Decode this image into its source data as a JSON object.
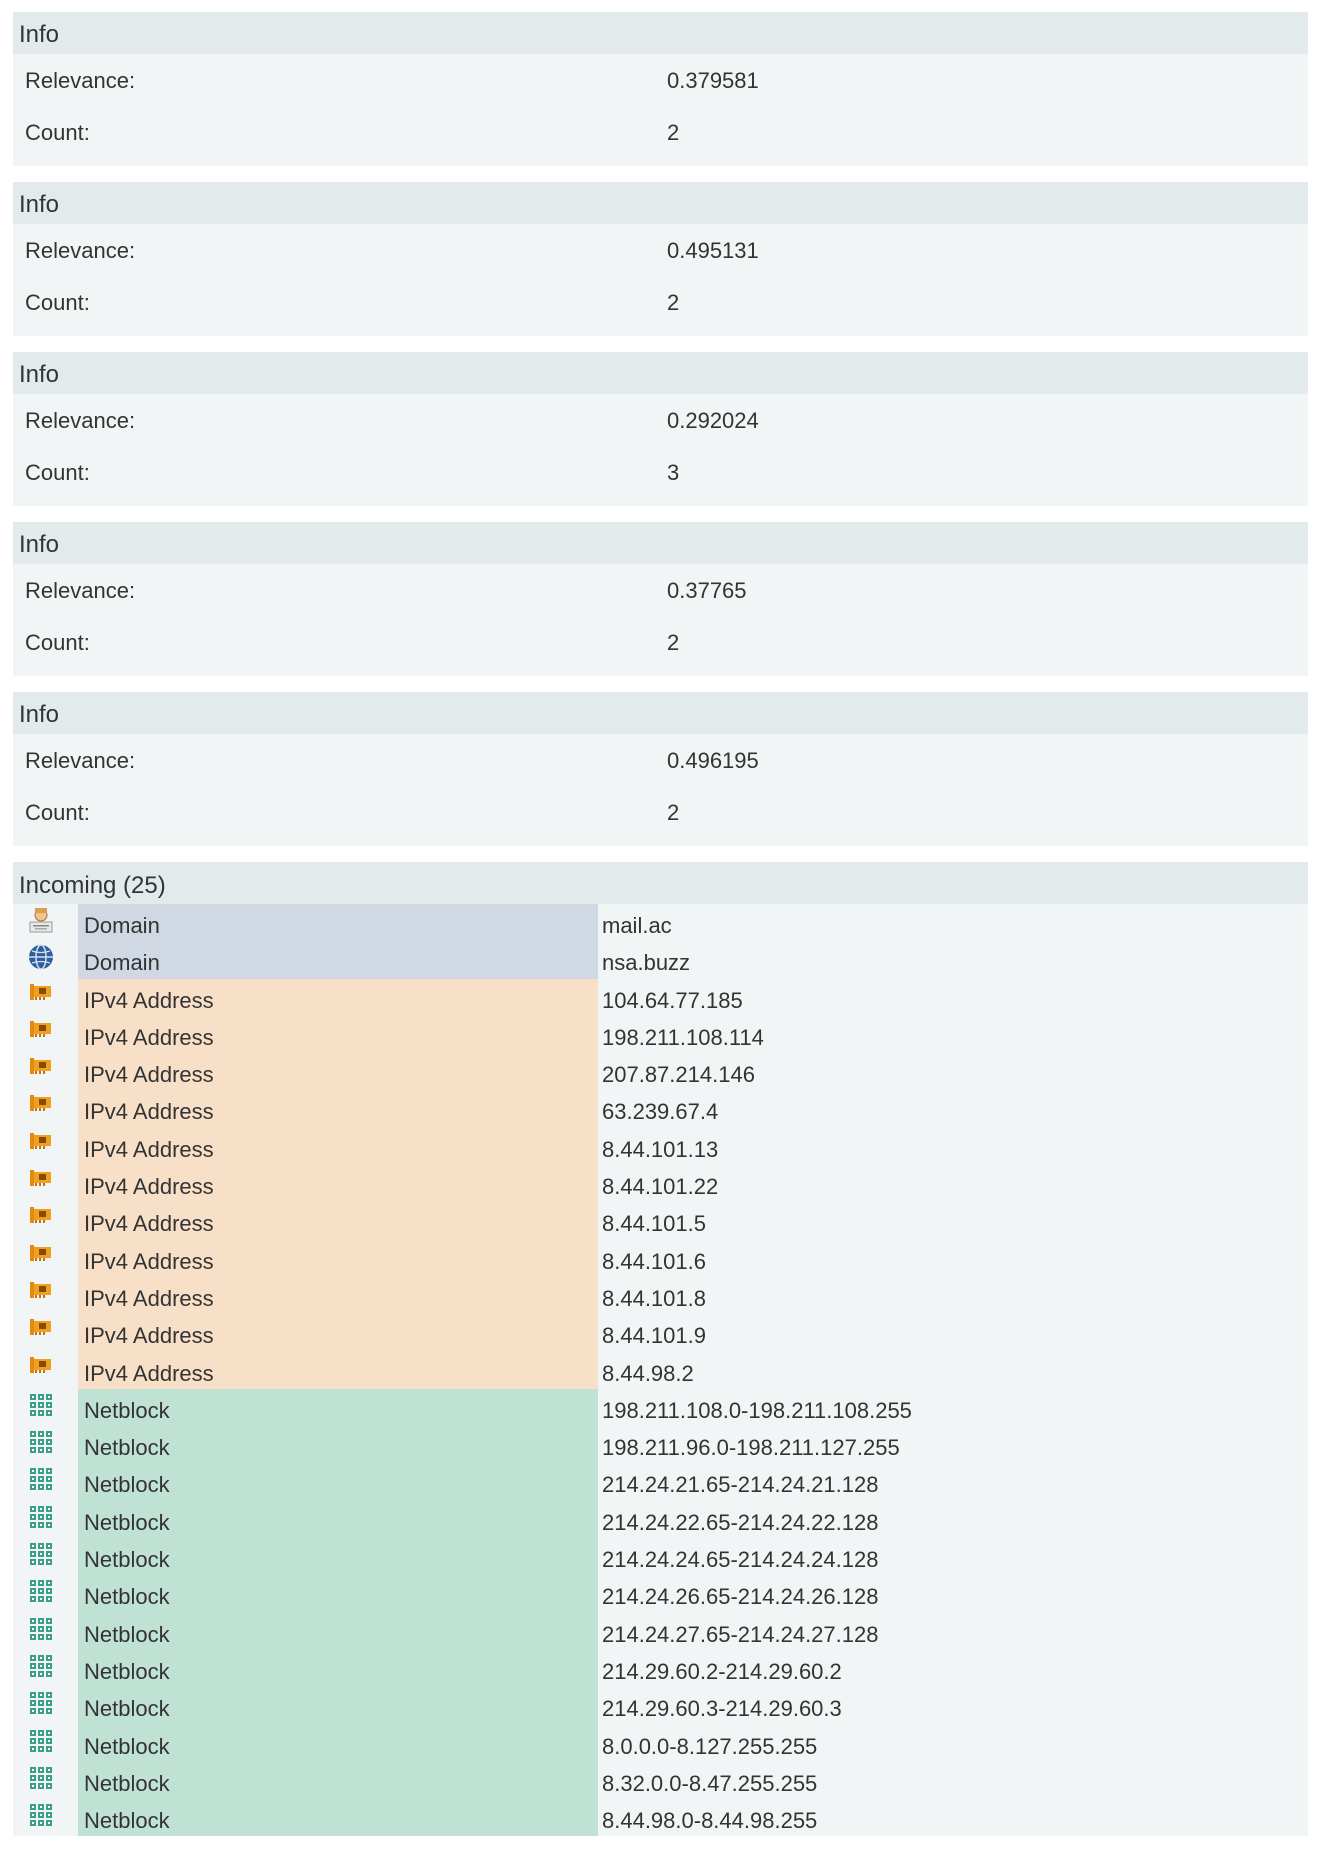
{
  "info_panels": [
    {
      "title": "Info",
      "relevance_label": "Relevance:",
      "relevance": "0.379581",
      "count_label": "Count:",
      "count": "2"
    },
    {
      "title": "Info",
      "relevance_label": "Relevance:",
      "relevance": "0.495131",
      "count_label": "Count:",
      "count": "2"
    },
    {
      "title": "Info",
      "relevance_label": "Relevance:",
      "relevance": "0.292024",
      "count_label": "Count:",
      "count": "3"
    },
    {
      "title": "Info",
      "relevance_label": "Relevance:",
      "relevance": "0.37765",
      "count_label": "Count:",
      "count": "2"
    },
    {
      "title": "Info",
      "relevance_label": "Relevance:",
      "relevance": "0.496195",
      "count_label": "Count:",
      "count": "2"
    }
  ],
  "incoming": {
    "title": "Incoming (25)",
    "rows": [
      {
        "icon": "person-icon",
        "type": "Domain",
        "kind": "domain",
        "value": "mail.ac"
      },
      {
        "icon": "globe-icon",
        "type": "Domain",
        "kind": "domain",
        "value": "nsa.buzz"
      },
      {
        "icon": "network-card-icon",
        "type": "IPv4 Address",
        "kind": "ipv4",
        "value": "104.64.77.185"
      },
      {
        "icon": "network-card-icon",
        "type": "IPv4 Address",
        "kind": "ipv4",
        "value": "198.211.108.114"
      },
      {
        "icon": "network-card-icon",
        "type": "IPv4 Address",
        "kind": "ipv4",
        "value": "207.87.214.146"
      },
      {
        "icon": "network-card-icon",
        "type": "IPv4 Address",
        "kind": "ipv4",
        "value": "63.239.67.4"
      },
      {
        "icon": "network-card-icon",
        "type": "IPv4 Address",
        "kind": "ipv4",
        "value": "8.44.101.13"
      },
      {
        "icon": "network-card-icon",
        "type": "IPv4 Address",
        "kind": "ipv4",
        "value": "8.44.101.22"
      },
      {
        "icon": "network-card-icon",
        "type": "IPv4 Address",
        "kind": "ipv4",
        "value": "8.44.101.5"
      },
      {
        "icon": "network-card-icon",
        "type": "IPv4 Address",
        "kind": "ipv4",
        "value": "8.44.101.6"
      },
      {
        "icon": "network-card-icon",
        "type": "IPv4 Address",
        "kind": "ipv4",
        "value": "8.44.101.8"
      },
      {
        "icon": "network-card-icon",
        "type": "IPv4 Address",
        "kind": "ipv4",
        "value": "8.44.101.9"
      },
      {
        "icon": "network-card-icon",
        "type": "IPv4 Address",
        "kind": "ipv4",
        "value": "8.44.98.2"
      },
      {
        "icon": "netblock-icon",
        "type": "Netblock",
        "kind": "netblock",
        "value": "198.211.108.0-198.211.108.255"
      },
      {
        "icon": "netblock-icon",
        "type": "Netblock",
        "kind": "netblock",
        "value": "198.211.96.0-198.211.127.255"
      },
      {
        "icon": "netblock-icon",
        "type": "Netblock",
        "kind": "netblock",
        "value": "214.24.21.65-214.24.21.128"
      },
      {
        "icon": "netblock-icon",
        "type": "Netblock",
        "kind": "netblock",
        "value": "214.24.22.65-214.24.22.128"
      },
      {
        "icon": "netblock-icon",
        "type": "Netblock",
        "kind": "netblock",
        "value": "214.24.24.65-214.24.24.128"
      },
      {
        "icon": "netblock-icon",
        "type": "Netblock",
        "kind": "netblock",
        "value": "214.24.26.65-214.24.26.128"
      },
      {
        "icon": "netblock-icon",
        "type": "Netblock",
        "kind": "netblock",
        "value": "214.24.27.65-214.24.27.128"
      },
      {
        "icon": "netblock-icon",
        "type": "Netblock",
        "kind": "netblock",
        "value": "214.29.60.2-214.29.60.2"
      },
      {
        "icon": "netblock-icon",
        "type": "Netblock",
        "kind": "netblock",
        "value": "214.29.60.3-214.29.60.3"
      },
      {
        "icon": "netblock-icon",
        "type": "Netblock",
        "kind": "netblock",
        "value": "8.0.0.0-8.127.255.255"
      },
      {
        "icon": "netblock-icon",
        "type": "Netblock",
        "kind": "netblock",
        "value": "8.32.0.0-8.47.255.255"
      },
      {
        "icon": "netblock-icon",
        "type": "Netblock",
        "kind": "netblock",
        "value": "8.44.98.0-8.44.98.255"
      }
    ]
  },
  "colors": {
    "panel_bg": "#f2f5f6",
    "header_bg": "#e3eaeb",
    "domain_bg": "#d0d8e4",
    "ipv4_bg": "#f8e0c8",
    "netblock_bg": "#c0e2d4"
  }
}
